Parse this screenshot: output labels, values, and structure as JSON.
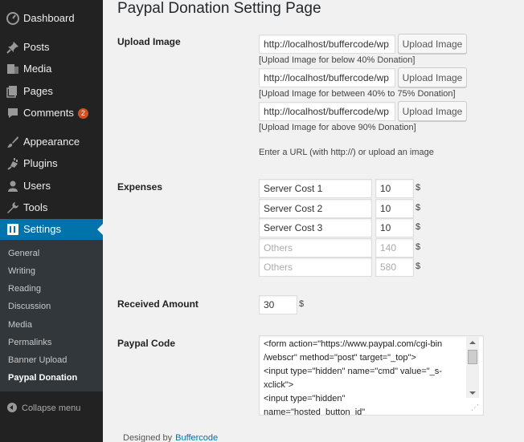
{
  "sidebar": {
    "items": [
      {
        "label": "Dashboard",
        "icon": "dashboard-icon"
      },
      {
        "label": "Posts",
        "icon": "pin-icon"
      },
      {
        "label": "Media",
        "icon": "media-icon"
      },
      {
        "label": "Pages",
        "icon": "pages-icon"
      },
      {
        "label": "Comments",
        "icon": "comment-icon",
        "badge": "2"
      },
      {
        "label": "Appearance",
        "icon": "paintbrush-icon"
      },
      {
        "label": "Plugins",
        "icon": "plugin-icon"
      },
      {
        "label": "Users",
        "icon": "user-icon"
      },
      {
        "label": "Tools",
        "icon": "wrench-icon"
      },
      {
        "label": "Settings",
        "icon": "settings-icon",
        "active": true
      }
    ],
    "submenu": [
      "General",
      "Writing",
      "Reading",
      "Discussion",
      "Media",
      "Permalinks",
      "Banner Upload",
      "Paypal Donation"
    ],
    "submenu_current": "Paypal Donation",
    "collapse_label": "Collapse menu"
  },
  "page": {
    "title": "Paypal Donation Setting Page"
  },
  "upload": {
    "label": "Upload Image",
    "button_label": "Upload Image",
    "rows": [
      {
        "value": "http://localhost/buffercode/wp",
        "caption": "[Upload Image for below 40% Donation]"
      },
      {
        "value": "http://localhost/buffercode/wp",
        "caption": "[Upload Image for between 40% to 75% Donation]"
      },
      {
        "value": "http://localhost/buffercode/wp",
        "caption": "[Upload Image for above 90% Donation]"
      }
    ],
    "help": "Enter a URL (with http://) or upload an image"
  },
  "expenses": {
    "label": "Expenses",
    "currency": "$",
    "rows": [
      {
        "name": "Server Cost 1",
        "amount": "10",
        "is_placeholder": false
      },
      {
        "name": "Server Cost 2",
        "amount": "10",
        "is_placeholder": false
      },
      {
        "name": "Server Cost 3",
        "amount": "10",
        "is_placeholder": false
      },
      {
        "name": "Others",
        "amount": "140",
        "is_placeholder": true
      },
      {
        "name": "Others",
        "amount": "580",
        "is_placeholder": true
      }
    ]
  },
  "received": {
    "label": "Received Amount",
    "value": "30",
    "currency": "$"
  },
  "paypal_code": {
    "label": "Paypal Code",
    "lines": [
      "<form action=\"https://www.paypal.com/cgi-bin",
      "/webscr\" method=\"post\" target=\"_top\">",
      "<input type=\"hidden\" name=\"cmd\" value=\"_s-",
      "xclick\">",
      "<input type=\"hidden\"",
      "name=\"hosted_button_id\""
    ]
  },
  "footer": {
    "text": "Designed by",
    "link": "Buffercode"
  },
  "colors": {
    "sidebar_bg": "#222222",
    "active_bg": "#0073aa",
    "page_bg": "#f1f1f1",
    "badge": "#d54e21"
  }
}
